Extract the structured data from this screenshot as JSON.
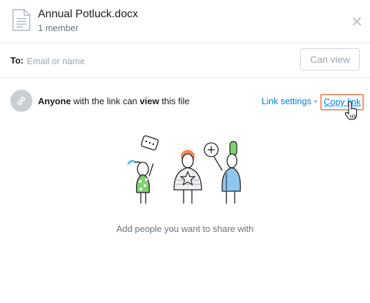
{
  "header": {
    "file_name": "Annual Potluck.docx",
    "member_count": "1 member",
    "file_icon": "document-icon",
    "close_icon": "close-icon"
  },
  "share": {
    "to_label": "To:",
    "input_placeholder": "Email or name",
    "permission_button": "Can view"
  },
  "link": {
    "icon": "link-icon",
    "text_prefix_bold": "Anyone",
    "text_middle": " with the link can ",
    "text_bold_2": "view",
    "text_suffix": " this file",
    "settings_label": "Link settings",
    "separator": "•",
    "copy_label": "Copy link"
  },
  "empty_state": {
    "message": "Add people you want to share with",
    "illustration": "people-sharing-illustration"
  },
  "colors": {
    "link_blue": "#007ee5",
    "highlight_orange": "#f0956c",
    "muted_text": "#637282",
    "border": "#e6e8eb"
  }
}
